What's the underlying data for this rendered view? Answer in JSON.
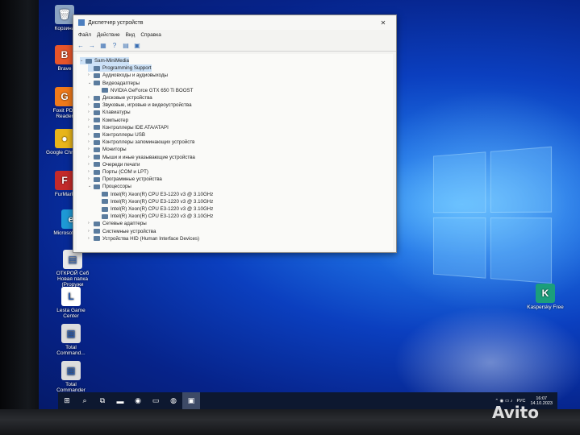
{
  "desktop": {
    "icons": [
      {
        "label": "Корзина",
        "glyph": "🗑",
        "color": "#8aa3c2"
      },
      {
        "label": "Brave",
        "glyph": "B",
        "color": "#e8552a"
      },
      {
        "label": "Foxit PDF Reader",
        "glyph": "G",
        "color": "#f07a1a"
      },
      {
        "label": "Google Chrome",
        "glyph": "●",
        "color": "#e8b51a"
      },
      {
        "label": "FurMark",
        "glyph": "F",
        "color": "#c42a2a"
      },
      {
        "label": "Microsoft Edge",
        "glyph": "e",
        "color": "#1e9ad6"
      },
      {
        "label": "ОТКРОЙ Себ Новая папка (Prоружи",
        "glyph": "▤",
        "color": "#e9e9e9"
      },
      {
        "label": "Lesta Game Center",
        "glyph": "L",
        "color": "#ffffff"
      },
      {
        "label": "Total Command...",
        "glyph": "▦",
        "color": "#ddd"
      },
      {
        "label": "Total Commander",
        "glyph": "▦",
        "color": "#ddd"
      },
      {
        "label": "Kaspersky Free",
        "glyph": "K",
        "color": "#1b9e7c"
      }
    ]
  },
  "window": {
    "title": "Диспетчер устройств",
    "close": "✕",
    "menu": [
      "Файл",
      "Действие",
      "Вид",
      "Справка"
    ],
    "toolbar": [
      "←",
      "→",
      "▦",
      "?",
      "▤",
      "▣"
    ],
    "tree": [
      {
        "label": "Sam-MiniMedia",
        "level": 0,
        "arrow": "⌄",
        "sel": true
      },
      {
        "label": "Programming Support",
        "level": 1,
        "arrow": "",
        "sel": true
      },
      {
        "label": "Аудиовходы и аудиовыходы",
        "level": 1,
        "arrow": "›"
      },
      {
        "label": "Видеоадаптеры",
        "level": 1,
        "arrow": "⌄"
      },
      {
        "label": "NVIDIA GeForce GTX 650 Ti BOOST",
        "level": 2,
        "arrow": ""
      },
      {
        "label": "Дисковые устройства",
        "level": 1,
        "arrow": "›"
      },
      {
        "label": "Звуковые, игровые и видеоустройства",
        "level": 1,
        "arrow": "›"
      },
      {
        "label": "Клавиатуры",
        "level": 1,
        "arrow": "›"
      },
      {
        "label": "Компьютер",
        "level": 1,
        "arrow": "›"
      },
      {
        "label": "Контроллеры IDE ATA/ATAPI",
        "level": 1,
        "arrow": "›"
      },
      {
        "label": "Контроллеры USB",
        "level": 1,
        "arrow": "›"
      },
      {
        "label": "Контроллеры запоминающих устройств",
        "level": 1,
        "arrow": "›"
      },
      {
        "label": "Мониторы",
        "level": 1,
        "arrow": "›"
      },
      {
        "label": "Мыши и иные указывающие устройства",
        "level": 1,
        "arrow": "›"
      },
      {
        "label": "Очереди печати",
        "level": 1,
        "arrow": "›"
      },
      {
        "label": "Порты (COM и LPT)",
        "level": 1,
        "arrow": "›"
      },
      {
        "label": "Программные устройства",
        "level": 1,
        "arrow": "›"
      },
      {
        "label": "Процессоры",
        "level": 1,
        "arrow": "⌄"
      },
      {
        "label": "Intel(R) Xeon(R) CPU E3-1220 v3 @ 3.10GHz",
        "level": 2,
        "arrow": ""
      },
      {
        "label": "Intel(R) Xeon(R) CPU E3-1220 v3 @ 3.10GHz",
        "level": 2,
        "arrow": ""
      },
      {
        "label": "Intel(R) Xeon(R) CPU E3-1220 v3 @ 3.10GHz",
        "level": 2,
        "arrow": ""
      },
      {
        "label": "Intel(R) Xeon(R) CPU E3-1220 v3 @ 3.10GHz",
        "level": 2,
        "arrow": ""
      },
      {
        "label": "Сетевые адаптеры",
        "level": 1,
        "arrow": "›"
      },
      {
        "label": "Системные устройства",
        "level": 1,
        "arrow": "›"
      },
      {
        "label": "Устройства HID (Human Interface Devices)",
        "level": 1,
        "arrow": "›"
      }
    ]
  },
  "taskbar": {
    "icons": [
      "⊞",
      "⌕",
      "⧉",
      "▬",
      "◉",
      "▭",
      "◍",
      "▣"
    ],
    "tray_lang": "РУС",
    "tray_icons": "⌃ ◉ ▭ ♪",
    "time": "16:07",
    "date": "14.10.2023"
  },
  "watermark": "Avito"
}
